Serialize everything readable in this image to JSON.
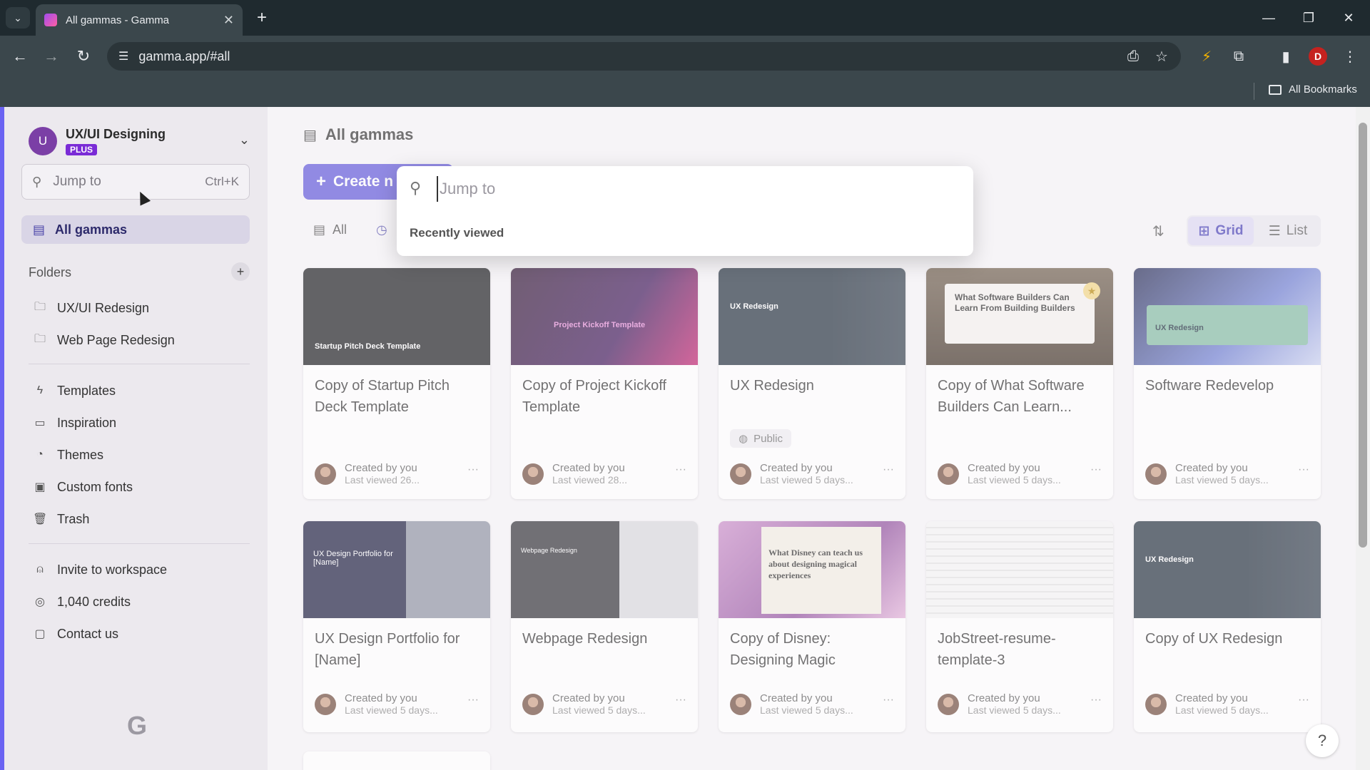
{
  "browser": {
    "tab_title": "All gammas - Gamma",
    "url": "gamma.app/#all",
    "bookmarks_label": "All Bookmarks",
    "profile_initial": "D"
  },
  "sidebar": {
    "workspace_initial": "U",
    "workspace_name": "UX/UI Designing",
    "workspace_plan": "PLUS",
    "search_placeholder": "Jump to",
    "search_shortcut": "Ctrl+K",
    "all_gammas": "All gammas",
    "folders_label": "Folders",
    "folders": [
      "UX/UI Redesign",
      "Web Page Redesign"
    ],
    "links": [
      "Templates",
      "Inspiration",
      "Themes",
      "Custom fonts",
      "Trash"
    ],
    "bottom_links": [
      "Invite to workspace",
      "1,040 credits",
      "Contact us"
    ]
  },
  "main": {
    "title": "All gammas",
    "create_label": "Create n",
    "filter_all": "All",
    "view_grid": "Grid",
    "view_list": "List"
  },
  "jump_modal": {
    "placeholder": "Jump to",
    "recently_viewed": "Recently viewed"
  },
  "cards": [
    {
      "title": "Copy of Startup Pitch Deck Template",
      "thumb_text": "Startup Pitch Deck Template",
      "created": "Created by you",
      "viewed": "Last viewed 26...",
      "thumb_color": "#15161a"
    },
    {
      "title": "Copy of Project Kickoff Template",
      "thumb_text": "Project Kickoff Template",
      "created": "Created by you",
      "viewed": "Last viewed 28...",
      "thumb_color": "#2a0f2e"
    },
    {
      "title": "UX Redesign",
      "thumb_text": "UX Redesign",
      "badge": "Public",
      "created": "Created by you",
      "viewed": "Last viewed 5 days...",
      "thumb_color": "#1d2a38"
    },
    {
      "title": "Copy of What Software Builders Can Learn...",
      "thumb_text": "What Software Builders Can Learn From Building Builders",
      "created": "Created by you",
      "viewed": "Last viewed 5 days...",
      "thumb_color": "#5c4a38"
    },
    {
      "title": "Software Redevelop",
      "thumb_text": "UX Redesign",
      "created": "Created by you",
      "viewed": "Last viewed 5 days...",
      "thumb_color": "#3e4a7c"
    },
    {
      "title": "UX Design Portfolio for [Name]",
      "thumb_text": "UX Design Portfolio for [Name]",
      "created": "Created by you",
      "viewed": "Last viewed 5 days...",
      "thumb_color": "#14163a"
    },
    {
      "title": "Webpage Redesign",
      "thumb_text": "Webpage Redesign",
      "created": "Created by you",
      "viewed": "Last viewed 5 days...",
      "thumb_color": "#2a2a30"
    },
    {
      "title": "Copy of Disney: Designing Magic",
      "thumb_text": "What Disney can teach us about designing magical experiences",
      "created": "Created by you",
      "viewed": "Last viewed 5 days...",
      "thumb_color": "#b06fb8"
    },
    {
      "title": "JobStreet-resume-template-3",
      "thumb_text": "",
      "created": "Created by you",
      "viewed": "Last viewed 5 days...",
      "thumb_color": "#f2f2f2"
    },
    {
      "title": "Copy of UX Redesign",
      "thumb_text": "UX Redesign",
      "created": "Created by you",
      "viewed": "Last viewed 5 days...",
      "thumb_color": "#1d2a38"
    }
  ],
  "colors": {
    "accent": "#5b52d9",
    "sidebar_bg": "#ece9ee",
    "page_bg": "#f6f4f7"
  }
}
